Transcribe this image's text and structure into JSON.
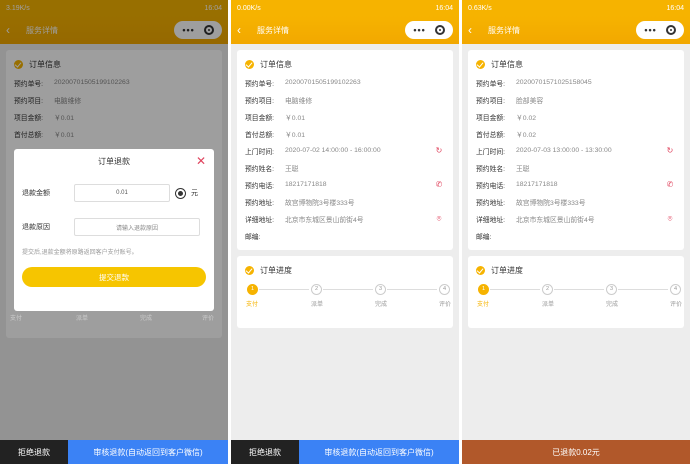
{
  "status": {
    "p1": {
      "speed": "3.19K/s",
      "time": "16:04"
    },
    "p2": {
      "speed": "0.00K/s",
      "time": "16:04"
    },
    "p3": {
      "speed": "0.63K/s",
      "time": "16:04"
    }
  },
  "nav": {
    "title": "服务详情",
    "back_icon": "chevron-left-icon",
    "menu_dots": "•••"
  },
  "labels": {
    "order_info": "订单信息",
    "order_progress": "订单进度",
    "order_no": "预约单号:",
    "item": "预约项目:",
    "amount": "项目金额:",
    "prepay": "首付总额:",
    "visit_time": "上门时间:",
    "name": "预约姓名:",
    "phone": "预约电话:",
    "address": "预约地址:",
    "detail_address": "详细地址:",
    "zip": "邮编:"
  },
  "orders": [
    {
      "no": "20200701505199102263",
      "item": "电脑维修",
      "amount": "￥0.01",
      "prepay": "￥0.01"
    },
    {
      "no": "20200701505199102263",
      "item": "电脑维修",
      "amount": "￥0.01",
      "prepay": "￥0.01",
      "time": "2020-07-02 14:00:00 - 16:00:00",
      "name": "王聪",
      "phone": "18217171818",
      "address": "故宫博物院3号楼333号",
      "detail": "北京市东城区景山前街4号"
    },
    {
      "no": "20200701571025158045",
      "item": "脸部美容",
      "amount": "￥0.02",
      "prepay": "￥0.02",
      "time": "2020-07-03 13:00:00 - 13:30:00",
      "name": "王聪",
      "phone": "18217171818",
      "address": "故宫博物院3号楼333号",
      "detail": "北京市东城区景山前街4号"
    }
  ],
  "progress": {
    "steps": [
      "1",
      "2",
      "3",
      "4"
    ],
    "labels": [
      "支付",
      "派单",
      "完成",
      "评价"
    ]
  },
  "modal": {
    "title": "订单退款",
    "amount_label": "退款金额",
    "amount_value": "0.01",
    "unit": "元",
    "reason_label": "退款原因",
    "reason_placeholder": "请输入退款原因",
    "note": "提交后,退款金额将原路返回客户支付账号。",
    "submit": "提交退款"
  },
  "bottom": {
    "reject": "拒绝退款",
    "approve": "审核退款(自动返回到客户微信)",
    "refunded": "已退款0.02元"
  },
  "colors": {
    "accent": "#f6b300",
    "blue": "#3b82f5",
    "brown": "#b1582a",
    "danger": "#e0445e"
  }
}
